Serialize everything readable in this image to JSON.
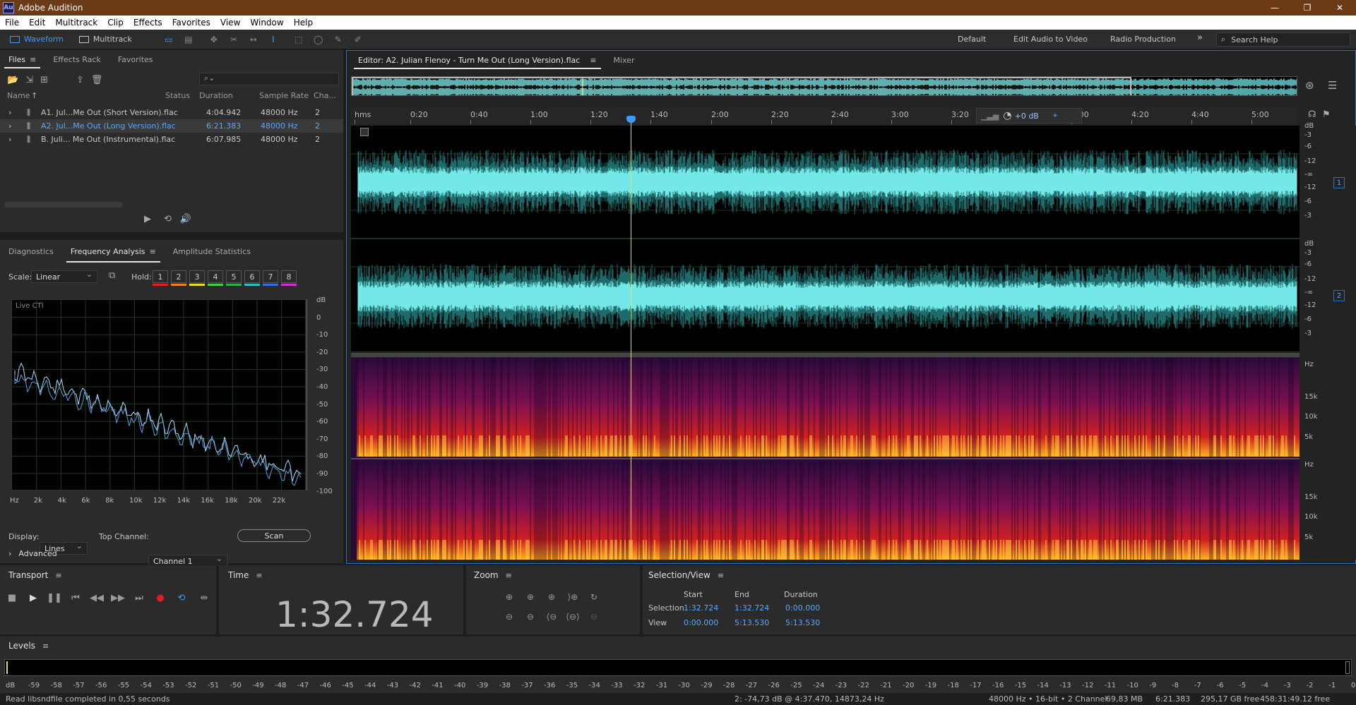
{
  "window": {
    "title": "Adobe Audition",
    "logo": "Au"
  },
  "menu": [
    "File",
    "Edit",
    "Multitrack",
    "Clip",
    "Effects",
    "Favorites",
    "View",
    "Window",
    "Help"
  ],
  "toolbar": {
    "waveform": "Waveform",
    "multitrack": "Multitrack",
    "workspaces": [
      "Default",
      "Edit Audio to Video",
      "Radio Production"
    ],
    "search_placeholder": "Search Help"
  },
  "files_panel": {
    "tabs": [
      "Files",
      "Effects Rack",
      "Favorites"
    ],
    "columns": [
      "Name",
      "Status",
      "Duration",
      "Sample Rate",
      "Cha..."
    ],
    "rows": [
      {
        "name": "A1. Jul...Me Out (Short Version).flac",
        "duration": "4:04.942",
        "rate": "48000 Hz",
        "ch": "2",
        "selected": false
      },
      {
        "name": "A2. Jul...Me Out (Long Version).flac",
        "duration": "6:21.383",
        "rate": "48000 Hz",
        "ch": "2",
        "selected": true
      },
      {
        "name": "B. Juli... Me Out (Instrumental).flac",
        "duration": "6:07.985",
        "rate": "48000 Hz",
        "ch": "2",
        "selected": false
      }
    ]
  },
  "analysis_panel": {
    "tabs": [
      "Diagnostics",
      "Frequency Analysis",
      "Amplitude Statistics"
    ],
    "scale_label": "Scale:",
    "scale_value": "Linear",
    "hold_label": "Hold:",
    "holds": [
      {
        "n": "1",
        "c": "#e02020"
      },
      {
        "n": "2",
        "c": "#f08020"
      },
      {
        "n": "3",
        "c": "#e8e020"
      },
      {
        "n": "4",
        "c": "#40d040"
      },
      {
        "n": "5",
        "c": "#30b050"
      },
      {
        "n": "6",
        "c": "#30c0c0"
      },
      {
        "n": "7",
        "c": "#3070e0"
      },
      {
        "n": "8",
        "c": "#d030d0"
      }
    ],
    "live_label": "Live CTI",
    "db_labels": [
      "dB",
      "0",
      "-10",
      "-20",
      "-30",
      "-40",
      "-50",
      "-60",
      "-70",
      "-80",
      "-90",
      "-100"
    ],
    "hz_labels": [
      "Hz",
      "2k",
      "4k",
      "6k",
      "8k",
      "10k",
      "12k",
      "14k",
      "16k",
      "18k",
      "20k",
      "22k"
    ],
    "display_label": "Display:",
    "display_value": "Lines",
    "top_channel_label": "Top Channel:",
    "top_channel_value": "Channel 1",
    "scan": "Scan",
    "advanced": "Advanced"
  },
  "editor": {
    "tab": "Editor: A2. Julian Flenoy - Turn Me Out (Long Version).flac",
    "mixer": "Mixer",
    "ruler": [
      "hms",
      "0:20",
      "0:40",
      "1:00",
      "1:20",
      "1:40",
      "2:00",
      "2:20",
      "2:40",
      "3:00",
      "3:20",
      "4:00",
      "4:20",
      "4:40",
      "5:00"
    ],
    "hud_gain": "+0 dB",
    "db_scale": [
      "dB",
      "-3",
      "-6",
      "-12",
      "-∞",
      "-12",
      "-6",
      "-3"
    ],
    "hz_scale": [
      "Hz",
      "15k",
      "10k",
      "5k"
    ],
    "channels": [
      "1",
      "2"
    ]
  },
  "transport": {
    "title": "Transport"
  },
  "time": {
    "title": "Time",
    "value": "1:32.724"
  },
  "zoom": {
    "title": "Zoom"
  },
  "selection": {
    "title": "Selection/View",
    "start": "Start",
    "end": "End",
    "duration": "Duration",
    "sel_label": "Selection",
    "view_label": "View",
    "sel_start": "1:32.724",
    "sel_end": "1:32.724",
    "sel_dur": "0:00.000",
    "view_start": "0:00.000",
    "view_end": "5:13.530",
    "view_dur": "5:13.530"
  },
  "levels": {
    "title": "Levels",
    "scale": [
      "dB",
      "-59",
      "-58",
      "-57",
      "-56",
      "-55",
      "-54",
      "-53",
      "-52",
      "-51",
      "-50",
      "-49",
      "-48",
      "-47",
      "-46",
      "-45",
      "-44",
      "-43",
      "-42",
      "-41",
      "-40",
      "-39",
      "-38",
      "-37",
      "-36",
      "-35",
      "-34",
      "-33",
      "-32",
      "-31",
      "-30",
      "-29",
      "-28",
      "-27",
      "-26",
      "-25",
      "-24",
      "-23",
      "-22",
      "-21",
      "-20",
      "-19",
      "-18",
      "-17",
      "-16",
      "-15",
      "-14",
      "-13",
      "-12",
      "-11",
      "-10",
      "-9",
      "-8",
      "-7",
      "-6",
      "-5",
      "-4",
      "-3",
      "-2",
      "-1",
      "0"
    ]
  },
  "status": {
    "left": "Read libsndfile completed in 0,55 seconds",
    "cursor": "2: -74,73 dB @ 4:37.470, 14873,24 Hz",
    "format": "48000 Hz • 16-bit • 2 Channel",
    "size": "69,83 MB",
    "duration": "6:21.383",
    "free": "295,17 GB free",
    "free_time": "458:31:49.12 free"
  }
}
